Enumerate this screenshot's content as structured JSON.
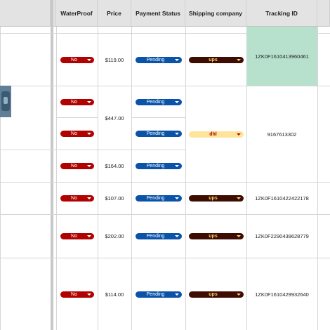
{
  "header": {
    "waterproof": "WaterProof",
    "price": "Price",
    "payment_status": "Payment Status",
    "shipping_company": "Shipping company",
    "tracking_id": "Tracking ID"
  },
  "rows": [
    {
      "waterproof": "No",
      "price": "$119.00",
      "payment": "Pending",
      "shipping": "ups",
      "tracking": "1ZK0F1610413960461"
    },
    {
      "waterproof": "No",
      "payment": "Pending"
    },
    {
      "waterproof": "No",
      "payment": "Pending"
    },
    {
      "waterproof": "No",
      "price": "$164.00",
      "payment": "Pending"
    },
    {
      "waterproof": "No",
      "price": "$107.00",
      "payment": "Pending",
      "shipping": "ups",
      "tracking": "1ZK0F1610422422178"
    },
    {
      "waterproof": "No",
      "price": "$202.00",
      "payment": "Pending",
      "shipping": "ups",
      "tracking": "1ZK0F2290439628779"
    },
    {
      "waterproof": "No",
      "price": "$114.00",
      "payment": "Pending",
      "shipping": "ups",
      "tracking": "1ZK0F1610429932640"
    }
  ],
  "merged": {
    "price": "$447.00",
    "shipping": "dhl",
    "tracking": "9167613302"
  },
  "colors": {
    "chip_no": "#b10202",
    "chip_pending": "#0a53a8",
    "chip_ups_bg": "#3d0d02",
    "chip_dhl_bg": "#ffe599",
    "selected_cell": "#b7e1cd"
  }
}
